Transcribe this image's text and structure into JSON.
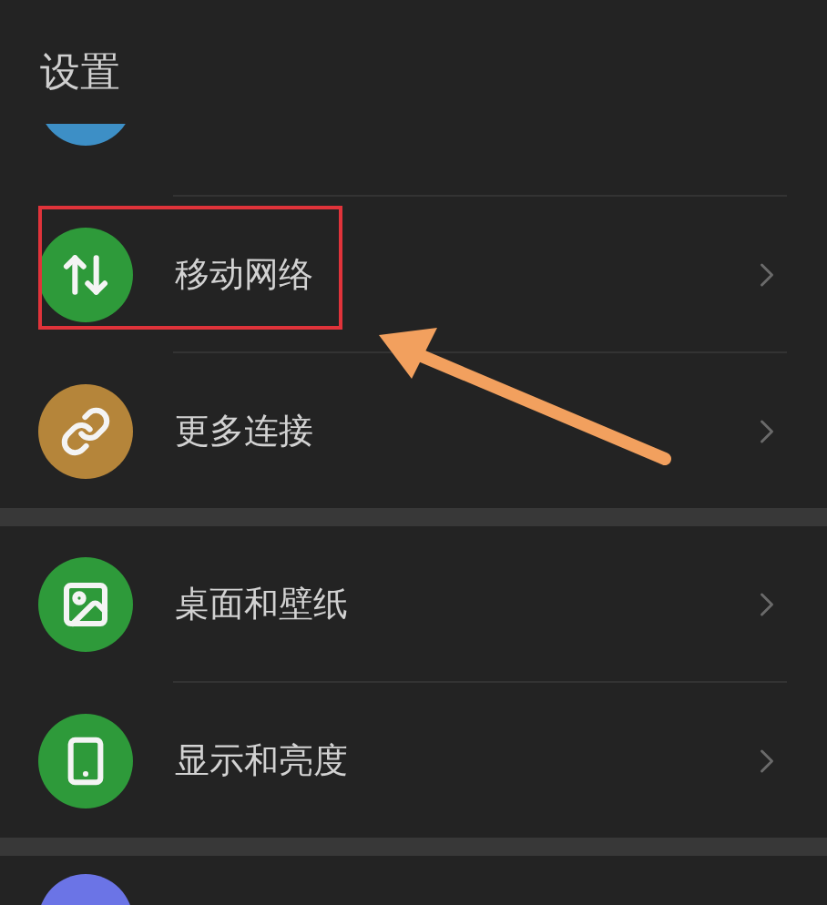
{
  "title": "设置",
  "groups": [
    {
      "items": [
        {
          "kind": "partial-top",
          "color": "#3d8fc6"
        },
        {
          "kind": "row",
          "color": "#2e9a3a",
          "label": "移动网络",
          "highlighted": true
        },
        {
          "kind": "row",
          "color": "#b5853a",
          "label": "更多连接",
          "highlighted": false
        }
      ]
    },
    {
      "items": [
        {
          "kind": "row",
          "color": "#2e9a3a",
          "label": "桌面和壁纸",
          "highlighted": false
        },
        {
          "kind": "row",
          "color": "#2e9a3a",
          "label": "显示和亮度",
          "highlighted": false
        }
      ]
    },
    {
      "items": [
        {
          "kind": "partial-bottom",
          "color": "#6b74e6"
        }
      ]
    }
  ],
  "arrow": true
}
